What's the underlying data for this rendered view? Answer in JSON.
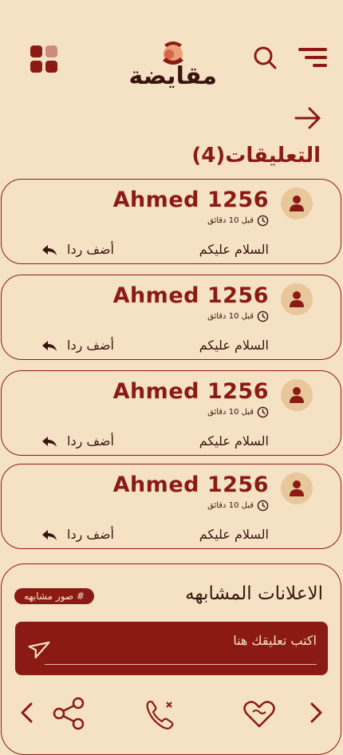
{
  "app": {
    "logo_text": "مقايضة"
  },
  "header": {
    "icons": [
      "grid-icon",
      "search-icon",
      "menu-icon",
      "arrow-right-icon"
    ]
  },
  "comments": {
    "title": "التعليقات(4)",
    "items": [
      {
        "user": "Ahmed 1256",
        "time": "قبل 10 دقائق",
        "text": "السلام عليكم",
        "reply_label": "أضف ردا"
      },
      {
        "user": "Ahmed 1256",
        "time": "قبل 10 دقائق",
        "text": "السلام عليكم",
        "reply_label": "أضف ردا"
      },
      {
        "user": "Ahmed 1256",
        "time": "قبل 10 دقائق",
        "text": "السلام عليكم",
        "reply_label": "أضف ردا"
      },
      {
        "user": "Ahmed 1256",
        "time": "قبل 10 دقائق",
        "text": "السلام عليكم",
        "reply_label": "أضف ردا"
      }
    ]
  },
  "similar": {
    "title": "الاعلانات المشابهه",
    "tag": "# صور مشابهه"
  },
  "composer": {
    "placeholder": "اكتب تعليقك هنا"
  },
  "bottom_nav": {
    "icons": [
      "chevron-left-icon",
      "share-icon",
      "phone-icon",
      "heart-icon",
      "chevron-right-icon"
    ]
  },
  "colors": {
    "background": "#f5e2c4",
    "primary": "#8b1a14",
    "dark_text": "#3b1410",
    "avatar_bg": "#e8c79a"
  }
}
